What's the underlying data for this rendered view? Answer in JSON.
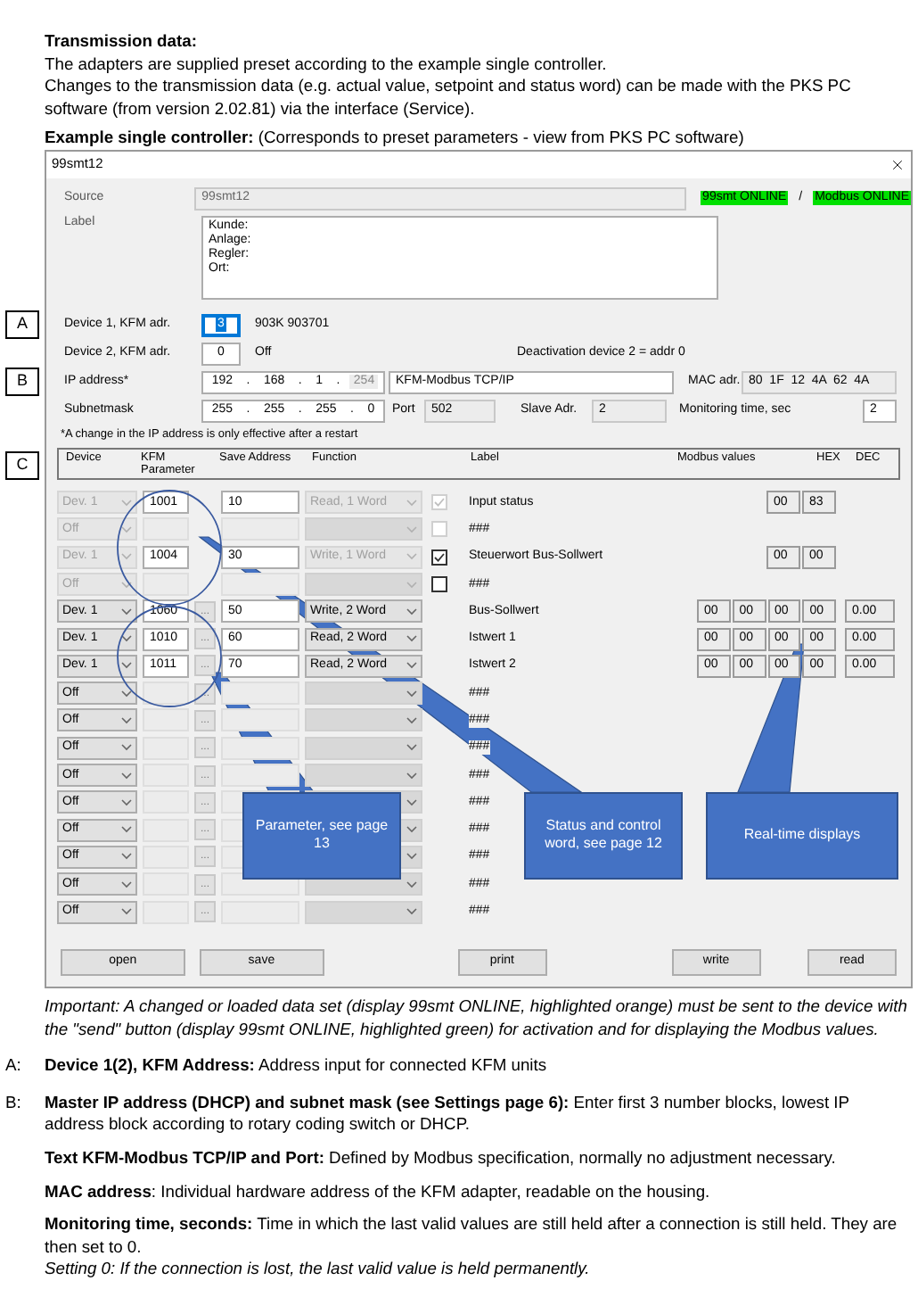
{
  "intro": {
    "heading": "Transmission data:",
    "lines": [
      "The adapters are supplied preset according to the example single controller.",
      "Changes to the transmission data (e.g. actual value, setpoint and status word) can be made with the PKS PC software (from version 2.02.81) via the interface (Service)."
    ],
    "caption": "**Example single controller:** (Corresponds to preset parameters - view from PKS PC software)"
  },
  "markers": [
    "A",
    "B",
    "C"
  ],
  "window": {
    "title": "99smt12",
    "source": {
      "label": "Source",
      "value": "99smt12"
    },
    "status": [
      {
        "text": "99smt ONLINE",
        "color": "#00e000"
      },
      {
        "text": "/"
      },
      {
        "text": "Modbus ONLINE",
        "color": "#00e000"
      }
    ],
    "label_field": {
      "label": "Label",
      "lines": [
        "Kunde:",
        "Anlage:",
        "Regler:",
        "Ort:"
      ]
    },
    "device1": {
      "label": "Device 1, KFM adr.",
      "value": "3",
      "selected": true,
      "info": "903K 903701"
    },
    "device2": {
      "label": "Device 2, KFM adr.",
      "value": "0",
      "selected": false,
      "info": "Off",
      "hint": "Deactivation device 2 = addr 0"
    },
    "ip": {
      "label": "IP address*",
      "parts": [
        {
          "value": "192",
          "disabled": false
        },
        {
          "value": "168",
          "disabled": false
        },
        {
          "value": "1",
          "disabled": false
        },
        {
          "value": "254",
          "disabled": true
        }
      ],
      "separator": ".",
      "name_value": "KFM-Modbus TCP/IP",
      "mac_label": "MAC adr.",
      "mac_value": "80  1F  12  4A  62  4A"
    },
    "subnet": {
      "label": "Subnetmask",
      "parts": [
        {
          "value": "255",
          "disabled": false
        },
        {
          "value": "255",
          "disabled": false
        },
        {
          "value": "255",
          "disabled": false
        },
        {
          "value": "0",
          "disabled": false
        }
      ],
      "separator": ".",
      "port_label": "Port",
      "port_value": "502",
      "slave_label": "Slave Adr.",
      "slave_value": "2",
      "monitor_label": "Monitoring time, sec",
      "monitor_value": "2"
    },
    "note": "*A change in the IP address is only effective after a restart",
    "grid": {
      "columns": [
        "Device",
        "KFM Parameter",
        "Save Address",
        "Function",
        "Label",
        "Modbus values",
        "HEX",
        "DEC"
      ],
      "rows": [
        {
          "device": "Dev. 1",
          "enabled": false,
          "parameter": "1001",
          "address": "10",
          "function": "Read, 1 Word",
          "browse": false,
          "check": {
            "checked": true,
            "disabled": true
          },
          "label": "Input status",
          "hex": [
            "00",
            "83"
          ]
        },
        {
          "device": "Off",
          "enabled": false,
          "browse": false,
          "check": {
            "checked": false,
            "disabled": true
          },
          "label": "###"
        },
        {
          "device": "Dev. 1",
          "enabled": false,
          "parameter": "1004",
          "address": "30",
          "function": "Write, 1 Word",
          "browse": false,
          "check": {
            "checked": true,
            "disabled": false
          },
          "label": "Steuerwort Bus-Sollwert",
          "hex": [
            "00",
            "00"
          ]
        },
        {
          "device": "Off",
          "enabled": false,
          "browse": false,
          "check": {
            "checked": false,
            "disabled": false
          },
          "label": "###"
        },
        {
          "device": "Dev. 1",
          "enabled": true,
          "parameter": "1060",
          "address": "50",
          "function": "Write, 2 Word",
          "browse": true,
          "label": "Bus-Sollwert",
          "hex": [
            "00",
            "00",
            "00",
            "00"
          ],
          "dec": "0.00"
        },
        {
          "device": "Dev. 1",
          "enabled": true,
          "parameter": "1010",
          "address": "60",
          "function": "Read, 2 Word",
          "browse": true,
          "label": "Istwert 1",
          "hex": [
            "00",
            "00",
            "00",
            "00"
          ],
          "dec": "0.00"
        },
        {
          "device": "Dev. 1",
          "enabled": true,
          "parameter": "1011",
          "address": "70",
          "function": "Read, 2 Word",
          "browse": true,
          "label": "Istwert 2",
          "hex": [
            "00",
            "00",
            "00",
            "00"
          ],
          "dec": "0.00"
        },
        {
          "device": "Off",
          "enabled": true,
          "browse": true,
          "label": "###"
        },
        {
          "device": "Off",
          "enabled": true,
          "browse": true,
          "label": "###"
        },
        {
          "device": "Off",
          "enabled": true,
          "browse": true,
          "label": "###"
        },
        {
          "device": "Off",
          "enabled": true,
          "browse": true,
          "label": "###"
        },
        {
          "device": "Off",
          "enabled": true,
          "browse": true,
          "label": "###"
        },
        {
          "device": "Off",
          "enabled": true,
          "browse": true,
          "label": "###"
        },
        {
          "device": "Off",
          "enabled": true,
          "browse": true,
          "label": "###"
        },
        {
          "device": "Off",
          "enabled": true,
          "browse": true,
          "label": "###"
        },
        {
          "device": "Off",
          "enabled": true,
          "browse": true,
          "label": "###"
        }
      ]
    },
    "browse_text": "...",
    "buttons": [
      "open",
      "save",
      "print",
      "write",
      "read"
    ],
    "callouts": [
      "Parameter, see page 13",
      "Status and control word, see page 12",
      "Real-time displays"
    ]
  },
  "important": "Important: A changed or loaded data set (display 99smt ONLINE, highlighted orange) must be sent to the device with the \"send\" button (display 99smt ONLINE, highlighted green) for activation and for displaying the Modbus values.",
  "notes": [
    {
      "marker": "A:",
      "paragraphs": [
        {
          "text": "**Device 1(2), KFM Address:** Address input for connected KFM units",
          "italic": false
        }
      ]
    },
    {
      "marker": "B:",
      "paragraphs": [
        {
          "text": "**Master IP address (DHCP) and subnet mask (see Settings page 6):** Enter first 3 number blocks, lowest IP address block according to rotary coding switch or DHCP.",
          "italic": false
        },
        {
          "text": "**Text KFM-Modbus TCP/IP and Port:** Defined by Modbus specification, normally no adjustment necessary.",
          "italic": false
        },
        {
          "text": "**MAC address**: Individual hardware address of the KFM adapter, readable on the housing.",
          "italic": false
        },
        {
          "text": "**Monitoring time, seconds:** Time in which the last valid values are still held after a connection is still held. They are then set to 0.",
          "italic": false
        },
        {
          "text": "Setting 0: If the connection is lost, the last valid value is held permanently.",
          "italic": true
        }
      ]
    }
  ]
}
